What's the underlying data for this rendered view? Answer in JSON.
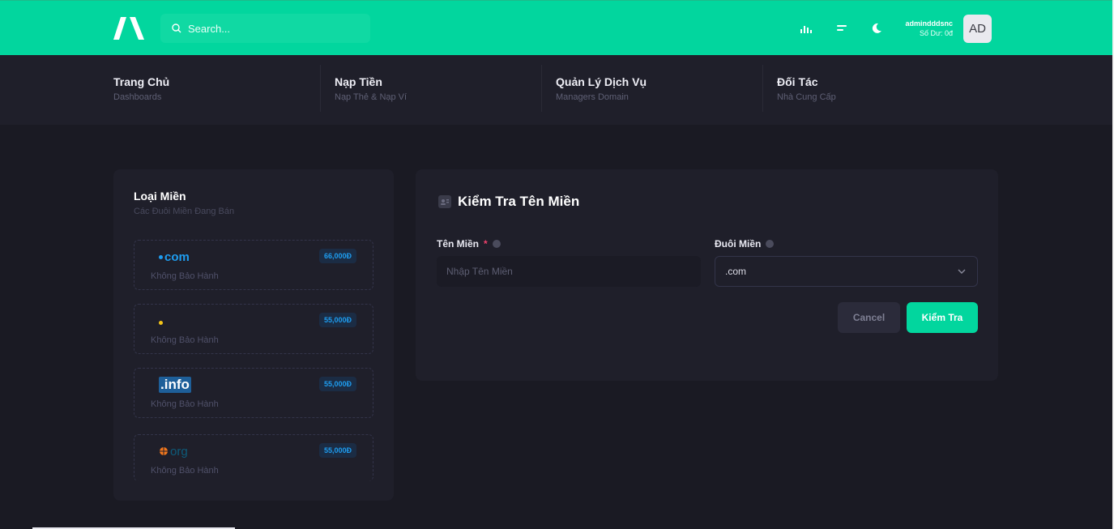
{
  "header": {
    "search_placeholder": "Search...",
    "user_name": "admindddsnc",
    "user_balance": "Số Dư: 0đ",
    "avatar_initials": "AD",
    "icons": [
      "logo-icon",
      "search-icon",
      "chart-icon",
      "menu-icon",
      "moon-icon"
    ]
  },
  "nav": [
    {
      "title": "Trang Chủ",
      "sub": "Dashboards"
    },
    {
      "title": "Nạp Tiền",
      "sub": "Nạp Thẻ & Nạp Ví"
    },
    {
      "title": "Quản Lý Dịch Vụ",
      "sub": "Managers Domain"
    },
    {
      "title": "Đối Tác",
      "sub": "Nhà Cung Cấp"
    }
  ],
  "domains_panel": {
    "title": "Loại Miền",
    "subtitle": "Các Đuôi Miền Đang Bán",
    "items": [
      {
        "logo_text": "com",
        "price": "66,000Đ",
        "warranty": "Không Bảo Hành"
      },
      {
        "logo_text": "",
        "price": "55,000Đ",
        "warranty": "Không Bảo Hành"
      },
      {
        "logo_text": ".info",
        "price": "55,000Đ",
        "warranty": "Không Bảo Hành"
      },
      {
        "logo_text": "org",
        "price": "55,000Đ",
        "warranty": "Không Bảo Hành"
      }
    ]
  },
  "check_form": {
    "title": "Kiểm Tra Tên Miền",
    "domain_label": "Tên Miền",
    "required_mark": "*",
    "domain_placeholder": "Nhập Tên Miền",
    "suffix_label": "Đuôi Miền",
    "suffix_value": ".com",
    "cancel_label": "Cancel",
    "submit_label": "Kiểm Tra"
  },
  "colors": {
    "brand": "#02d69e",
    "background": "#1a1a23",
    "card": "#1f1f2a",
    "price_text": "#1e9df0",
    "required": "#f1416c"
  }
}
